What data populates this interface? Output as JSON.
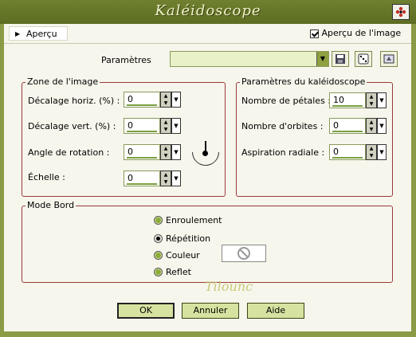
{
  "window": {
    "title": "Kaléidoscope"
  },
  "preview": {
    "tab_label": "Aperçu",
    "checkbox_label": "Aperçu de l'image",
    "checked": true
  },
  "params": {
    "label": "Paramètres",
    "value": ""
  },
  "image_zone": {
    "title": "Zone de l'image",
    "fields": [
      {
        "label": "Décalage horiz. (%) :",
        "value": "0"
      },
      {
        "label": "Décalage vert. (%) :",
        "value": "0"
      },
      {
        "label": "Angle de rotation :",
        "value": "0"
      },
      {
        "label": "Échelle :",
        "value": "0"
      }
    ]
  },
  "kaleido": {
    "title": "Paramètres du kaléidoscope",
    "fields": [
      {
        "label": "Nombre de pétales :",
        "value": "10"
      },
      {
        "label": "Nombre d'orbites :",
        "value": "0"
      },
      {
        "label": "Aspiration radiale :",
        "value": "0"
      }
    ]
  },
  "edge_mode": {
    "title": "Mode Bord",
    "options": [
      "Enroulement",
      "Répétition",
      "Couleur",
      "Reflet"
    ],
    "selected": "Répétition"
  },
  "watermark": "Tilounc",
  "buttons": {
    "ok": "OK",
    "cancel": "Annuler",
    "help": "Aide"
  },
  "colors": {
    "frame": "#8b9b45",
    "accent": "#8fa040",
    "group_border": "#9a3a3a"
  }
}
